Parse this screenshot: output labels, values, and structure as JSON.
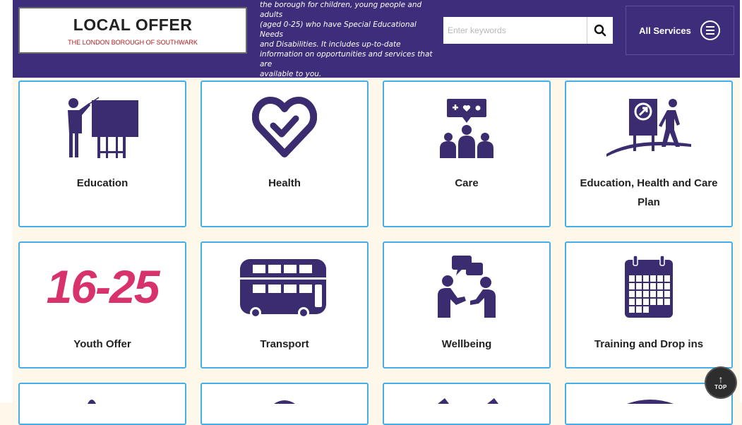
{
  "header": {
    "logo_title": "LOCAL OFFER",
    "logo_subtitle": "THE LONDON BOROUGH OF SOUTHWARK",
    "intro_lines": [
      "the borough for children, young people and adults",
      "(aged 0-25) who have Special Educational Needs",
      "and Disabilities. It includes up-to-date",
      "information on opportunities and services that are",
      "available to you."
    ],
    "search_placeholder": "Enter keywords",
    "all_services_label": "All Services"
  },
  "tiles": [
    {
      "label": "Education",
      "icon": "teacher-board-icon"
    },
    {
      "label": "Health",
      "icon": "heart-check-icon"
    },
    {
      "label": "Care",
      "icon": "group-care-icon"
    },
    {
      "label": "Education, Health and Care Plan",
      "icon": "person-sign-icon"
    },
    {
      "label": "Youth Offer",
      "icon": "youth-16-25-logo",
      "logo_text": "16-25"
    },
    {
      "label": "Transport",
      "icon": "bus-icon"
    },
    {
      "label": "Wellbeing",
      "icon": "people-talking-icon"
    },
    {
      "label": "Training and Drop ins",
      "icon": "calendar-icon"
    }
  ],
  "top_button": {
    "label": "TOP",
    "arrow": "↑"
  },
  "colors": {
    "header_bg": "#3d2d7a",
    "tile_border": "#45aee8",
    "icon_color": "#3b2c70",
    "youth_pink": "#d8326c",
    "page_bg": "#fdf8ea"
  }
}
